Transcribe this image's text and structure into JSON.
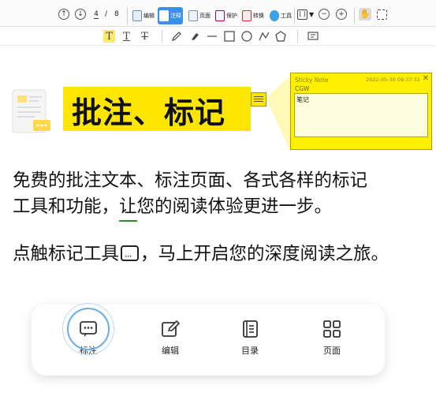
{
  "toolbar": {
    "page_current": "4",
    "page_total": "8",
    "tools": [
      {
        "label": "编辑",
        "active": false
      },
      {
        "label": "注释",
        "active": true
      },
      {
        "label": "页面",
        "active": false
      },
      {
        "label": "保护",
        "active": false
      },
      {
        "label": "转换",
        "active": false
      },
      {
        "label": "工具",
        "active": false
      }
    ],
    "accent": "#3b8fe8"
  },
  "annotation_bar": {
    "icons": [
      "highlight-text-icon",
      "underline-text-icon",
      "strikeout-text-icon",
      "pencil-icon",
      "eraser-icon",
      "line-icon",
      "rectangle-icon",
      "ellipse-icon",
      "polyline-icon",
      "polygon-icon",
      "comment-icon"
    ]
  },
  "content": {
    "banner_title": "批注、标记",
    "banner_color": "#ffe600",
    "paragraph1_line1": "免费的批注文本、标注页面、各式各样的标记",
    "paragraph1_line2_a": "工具和功能，",
    "paragraph1_line2_b": "让",
    "paragraph1_line2_c": "您的阅读体验更进一步。",
    "paragraph2_a": "点触标记工具",
    "paragraph2_b": "，马上开启您的深度阅读之旅。"
  },
  "sticky_note": {
    "title": "Sticky Note",
    "timestamp": "2022-05-30 09:37:31",
    "author": "CGW",
    "body": "笔记",
    "color": "#ffef00"
  },
  "bottom_card": {
    "items": [
      {
        "label": "标注",
        "icon": "comment-icon"
      },
      {
        "label": "编辑",
        "icon": "edit-icon"
      },
      {
        "label": "目录",
        "icon": "toc-icon"
      },
      {
        "label": "页面",
        "icon": "grid-icon"
      }
    ]
  }
}
